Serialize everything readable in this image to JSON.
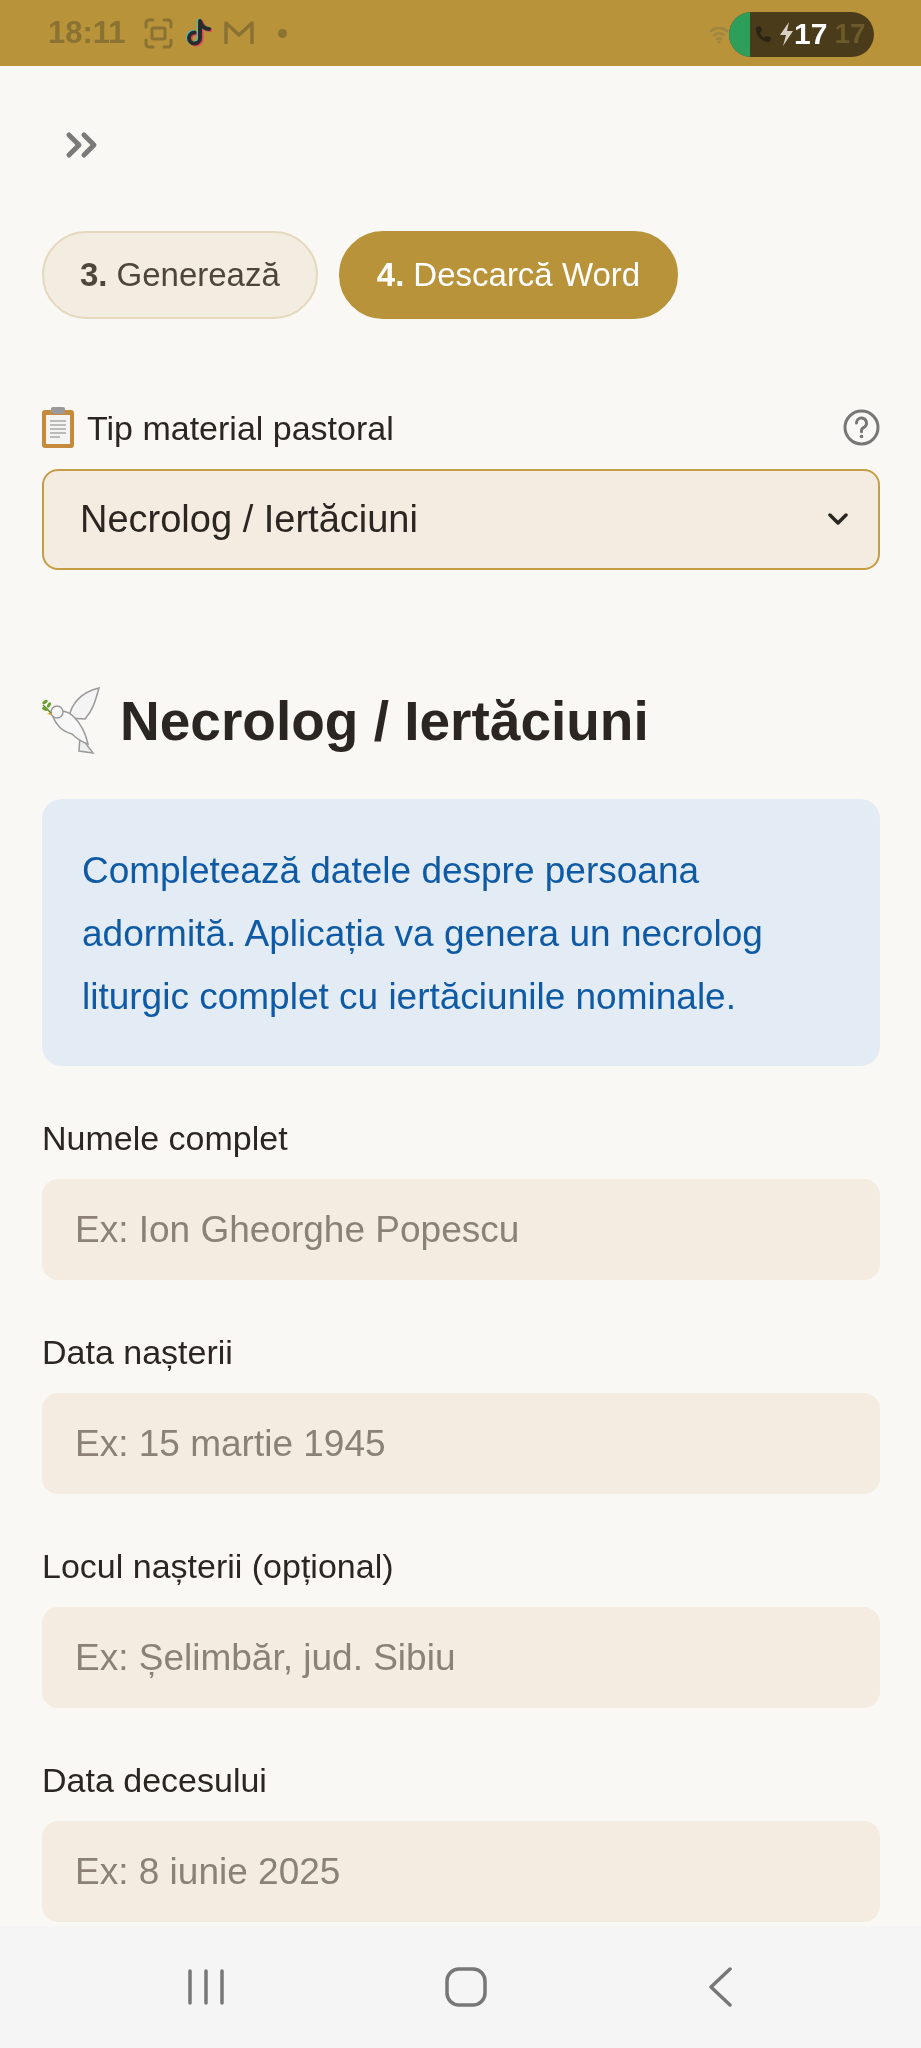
{
  "status_bar": {
    "time": "18:11",
    "battery": "17",
    "battery_faint": "17"
  },
  "tabs": [
    {
      "number": "3.",
      "label": "Generează",
      "selected": false
    },
    {
      "number": "4.",
      "label": "Descarcă Word",
      "selected": true
    }
  ],
  "material_type": {
    "label": "Tip material pastoral",
    "value": "Necrolog / Iertăciuni"
  },
  "section": {
    "title": "Necrolog / Iertăciuni",
    "info": "Completează datele despre persoana adormită. Aplicația va genera un necrolog liturgic complet cu iertăciunile nominale."
  },
  "fields": [
    {
      "label": "Numele complet",
      "placeholder": "Ex: Ion Gheorghe Popescu"
    },
    {
      "label": "Data nașterii",
      "placeholder": "Ex: 15 martie 1945"
    },
    {
      "label": "Locul nașterii (opțional)",
      "placeholder": "Ex: Șelimbăr, jud. Sibiu"
    },
    {
      "label": "Data decesului",
      "placeholder": "Ex: 8 iunie 2025"
    }
  ]
}
